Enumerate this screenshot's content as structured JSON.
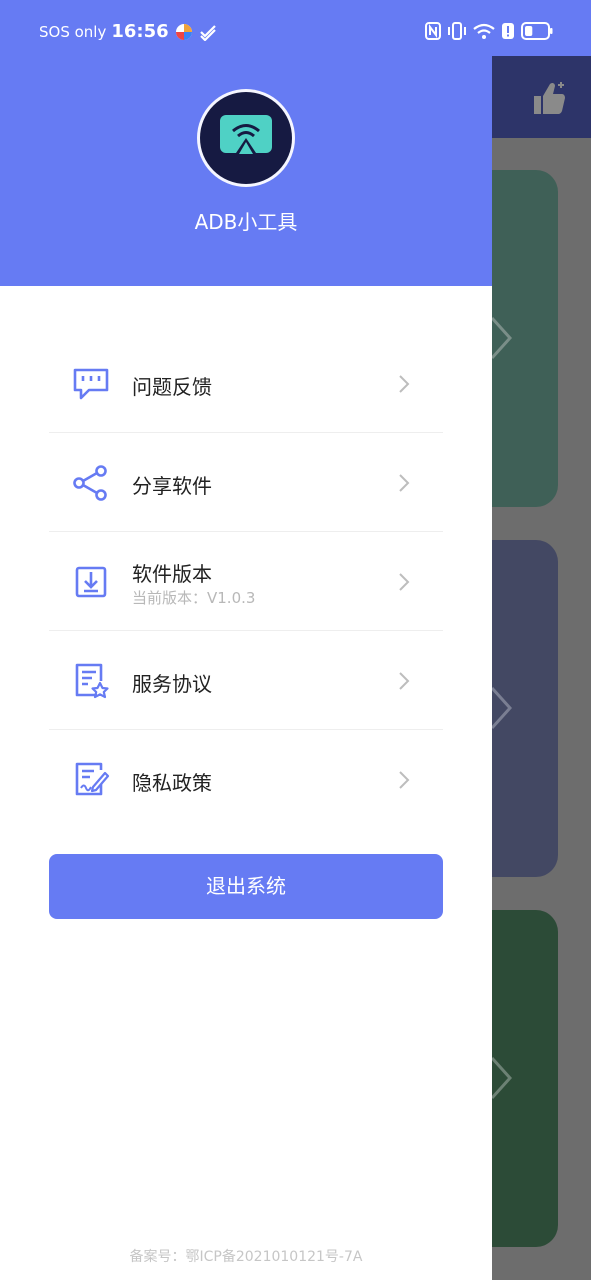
{
  "status_bar": {
    "carrier": "SOS only",
    "time": "16:56",
    "battery_level": 0.35
  },
  "drawer": {
    "app_name": "ADB小工具",
    "menu": [
      {
        "label": "问题反馈",
        "icon": "feedback-icon"
      },
      {
        "label": "分享软件",
        "icon": "share-icon"
      },
      {
        "label": "软件版本",
        "sub": "当前版本：V1.0.3",
        "icon": "download-icon"
      },
      {
        "label": "服务协议",
        "icon": "agreement-icon"
      },
      {
        "label": "隐私政策",
        "icon": "privacy-policy-icon"
      }
    ],
    "logout_label": "退出系统",
    "icp": "备案号：鄂ICP备2021010121号-7A"
  },
  "colors": {
    "primary": "#667bf3",
    "avatar_bg": "#161a42",
    "logo_teal": "#4fd1c5"
  }
}
